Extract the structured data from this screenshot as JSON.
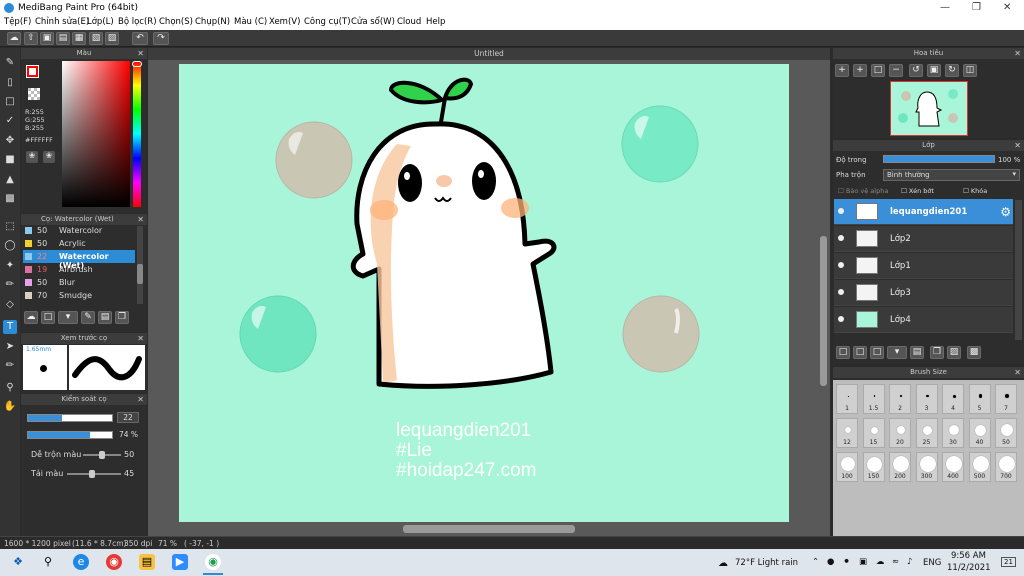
{
  "window": {
    "title": "MediBang Paint Pro (64bit)"
  },
  "menu": [
    "Tệp(F)",
    "Chỉnh sửa(E)",
    "Lớp(L)",
    "Bộ lọc(R)",
    "Chọn(S)",
    "Chụp(N)",
    "Màu (C)",
    "Xem(V)",
    "Công cụ(T)",
    "Cửa sổ(W)",
    "Cloud",
    "Help"
  ],
  "color_panel": {
    "title": "Màu",
    "r": "R:255",
    "g": "G:255",
    "b": "B:255",
    "hex": "#FFFFFF",
    "primary": "#ff0000",
    "secondary": "#ffffff"
  },
  "brush_panel": {
    "title": "Cọ: Watercolor (Wet)",
    "items": [
      {
        "size": "50",
        "name": "Watercolor",
        "color": "#8ec8f0"
      },
      {
        "size": "50",
        "name": "Acrylic",
        "color": "#f0d030"
      },
      {
        "size": "22",
        "name": "Watercolor (Wet)",
        "color": "#8ec8f0"
      },
      {
        "size": "19",
        "name": "Airbrush",
        "color": "#e070a0"
      },
      {
        "size": "50",
        "name": "Blur",
        "color": "#e8a0e8"
      },
      {
        "size": "70",
        "name": "Smudge",
        "color": "#d8d0c0"
      }
    ]
  },
  "preview_panel": {
    "title": "Xem trước cọ",
    "size": "1.65mm"
  },
  "control_panel": {
    "title": "Kiểm soát cọ",
    "size": "22",
    "size_fraction": 0.4,
    "opacity": "74 %",
    "opacity_fraction": 0.74,
    "blend_label": "Dễ trộn màu",
    "blend_value": "50",
    "blend_fraction": 0.5,
    "reload_label": "Tải màu",
    "reload_value": "45",
    "reload_fraction": 0.45
  },
  "canvas": {
    "tab": "Untitled",
    "bg": "#a8f5da",
    "watermark": [
      "lequangdien201",
      "#Lie",
      "#hoidap247.com"
    ]
  },
  "navigator": {
    "title": "Hoa tiêu"
  },
  "layers": {
    "title": "Lớp",
    "opacity_label": "Độ trong",
    "opacity_value": "100 %",
    "blend_label": "Pha trộn",
    "blend_value": "Bình thường",
    "protect_alpha": "Bảo vệ alpha",
    "clipping": "Xén bớt",
    "lock": "Khóa",
    "items": [
      {
        "name": "lequangdien201",
        "selected": true
      },
      {
        "name": "Lớp2",
        "selected": false
      },
      {
        "name": "Lớp1",
        "selected": false
      },
      {
        "name": "Lớp3",
        "selected": false
      },
      {
        "name": "Lớp4",
        "selected": false
      }
    ]
  },
  "brush_size": {
    "title": "Brush Size",
    "sizes": [
      "1",
      "1.5",
      "2",
      "3",
      "4",
      "5",
      "7",
      "12",
      "15",
      "20",
      "25",
      "30",
      "40",
      "50",
      "100",
      "150",
      "200",
      "300",
      "400",
      "500",
      "700"
    ]
  },
  "status": {
    "dims": "1600 * 1200 pixel",
    "cm": "(11.6 * 8.7cm)",
    "dpi": "350 dpi",
    "zoom": "71 %",
    "coords": "( -37, -1 )"
  },
  "taskbar": {
    "weather": "72°F  Light rain",
    "lang": "ENG",
    "time": "9:56 AM",
    "date": "11/2/2021",
    "badge": "21"
  }
}
